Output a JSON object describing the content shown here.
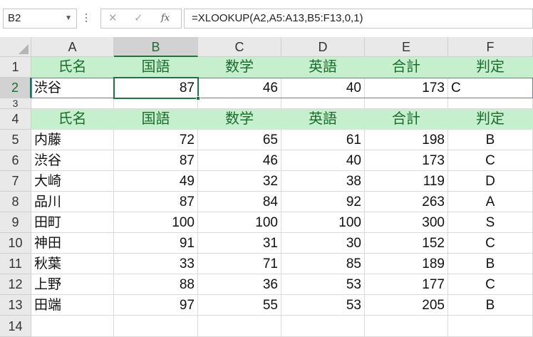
{
  "formula_bar": {
    "name_box": "B2",
    "cancel_icon": "✕",
    "enter_icon": "✓",
    "fx_label": "fx",
    "formula": "=XLOOKUP(A2,A5:A13,B5:F13,0,1)"
  },
  "columns": [
    "A",
    "B",
    "C",
    "D",
    "E",
    "F"
  ],
  "rows": [
    "1",
    "2",
    "3",
    "4",
    "5",
    "6",
    "7",
    "8",
    "9",
    "10",
    "11",
    "12",
    "13",
    "14"
  ],
  "header": [
    "氏名",
    "国語",
    "数学",
    "英語",
    "合計",
    "判定"
  ],
  "lookup_row": [
    "渋谷",
    "87",
    "46",
    "40",
    "173",
    "C"
  ],
  "table": [
    [
      "内藤",
      "72",
      "65",
      "61",
      "198",
      "B"
    ],
    [
      "渋谷",
      "87",
      "46",
      "40",
      "173",
      "C"
    ],
    [
      "大崎",
      "49",
      "32",
      "38",
      "119",
      "D"
    ],
    [
      "品川",
      "87",
      "84",
      "92",
      "263",
      "A"
    ],
    [
      "田町",
      "100",
      "100",
      "100",
      "300",
      "S"
    ],
    [
      "神田",
      "91",
      "31",
      "30",
      "152",
      "C"
    ],
    [
      "秋葉",
      "33",
      "71",
      "85",
      "189",
      "B"
    ],
    [
      "上野",
      "88",
      "36",
      "53",
      "177",
      "C"
    ],
    [
      "田端",
      "97",
      "55",
      "53",
      "205",
      "B"
    ]
  ],
  "colors": {
    "header_fill": "#c6efce",
    "header_text": "#1b6b2c",
    "selection": "#217346"
  }
}
